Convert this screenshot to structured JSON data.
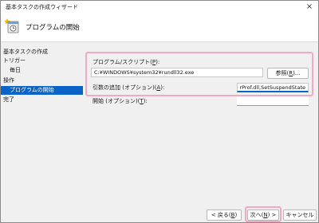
{
  "window": {
    "title": "基本タスクの作成ウィザード",
    "close_glyph": "×"
  },
  "header": {
    "page_title": "プログラムの開始",
    "icon": "task-wizard-icon"
  },
  "sidebar": {
    "steps": [
      {
        "label": "基本タスクの作成",
        "indent": 0,
        "selected": false
      },
      {
        "label": "トリガー",
        "indent": 0,
        "selected": false
      },
      {
        "label": "毎日",
        "indent": 1,
        "selected": false
      },
      {
        "label": "操作",
        "indent": 0,
        "selected": false
      },
      {
        "label": "プログラムの開始",
        "indent": 1,
        "selected": true
      },
      {
        "label": "完了",
        "indent": 0,
        "selected": false
      }
    ]
  },
  "form": {
    "program_label": "プログラム/スクリプト(",
    "program_label_key": "P",
    "program_label_end": "):",
    "program_value": "C:¥WINDOWS¥system32¥rundll32.exe",
    "browse_label": "参照(",
    "browse_key": "R",
    "browse_end": ")...",
    "args_label": "引数の追加 (オプション)(",
    "args_key": "A",
    "args_end": "):",
    "args_value": "rProf.dll,SetSuspendState",
    "start_label": "開始 (オプション)(",
    "start_key": "T",
    "start_end": "):",
    "start_value": ""
  },
  "footer": {
    "back_label": "< 戻る(",
    "back_key": "B",
    "back_end": ")",
    "next_label": "次へ(",
    "next_key": "N",
    "next_end": ") >",
    "cancel_label": "キャンセル"
  },
  "colors": {
    "accent": "#0a64c8",
    "highlight": "#f2a9c4"
  }
}
